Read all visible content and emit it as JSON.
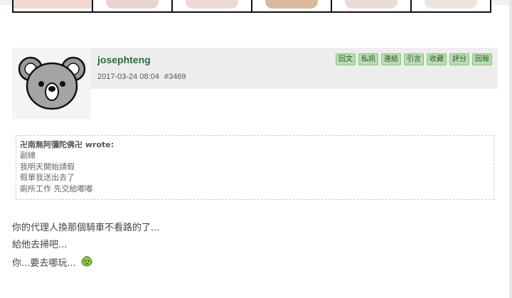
{
  "post": {
    "username": "josephteng",
    "date": "2017-03-24 08:04",
    "post_number": "#3469",
    "actions": [
      "回文",
      "私訊",
      "連結",
      "引言",
      "收藏",
      "評分",
      "回報"
    ]
  },
  "quote": {
    "author": "卍南無阿彌陀佛卍 wrote:",
    "lines": [
      "副總",
      "我明天開始請假",
      "假單我送出去了",
      "廁所工作 先交給嘟嘟"
    ]
  },
  "body": {
    "lines": [
      "你的代理人換那個騎車不看路的了...",
      "給他去掃吧...",
      "你...要去哪玩..."
    ]
  },
  "icons": {
    "avatar": "koala-avatar-icon",
    "emoji": "green-blob-emoji-icon"
  },
  "colors": {
    "username": "#2e6b34",
    "action_button_bg": "#b9dcb0",
    "header_bg": "#eeeeee"
  }
}
